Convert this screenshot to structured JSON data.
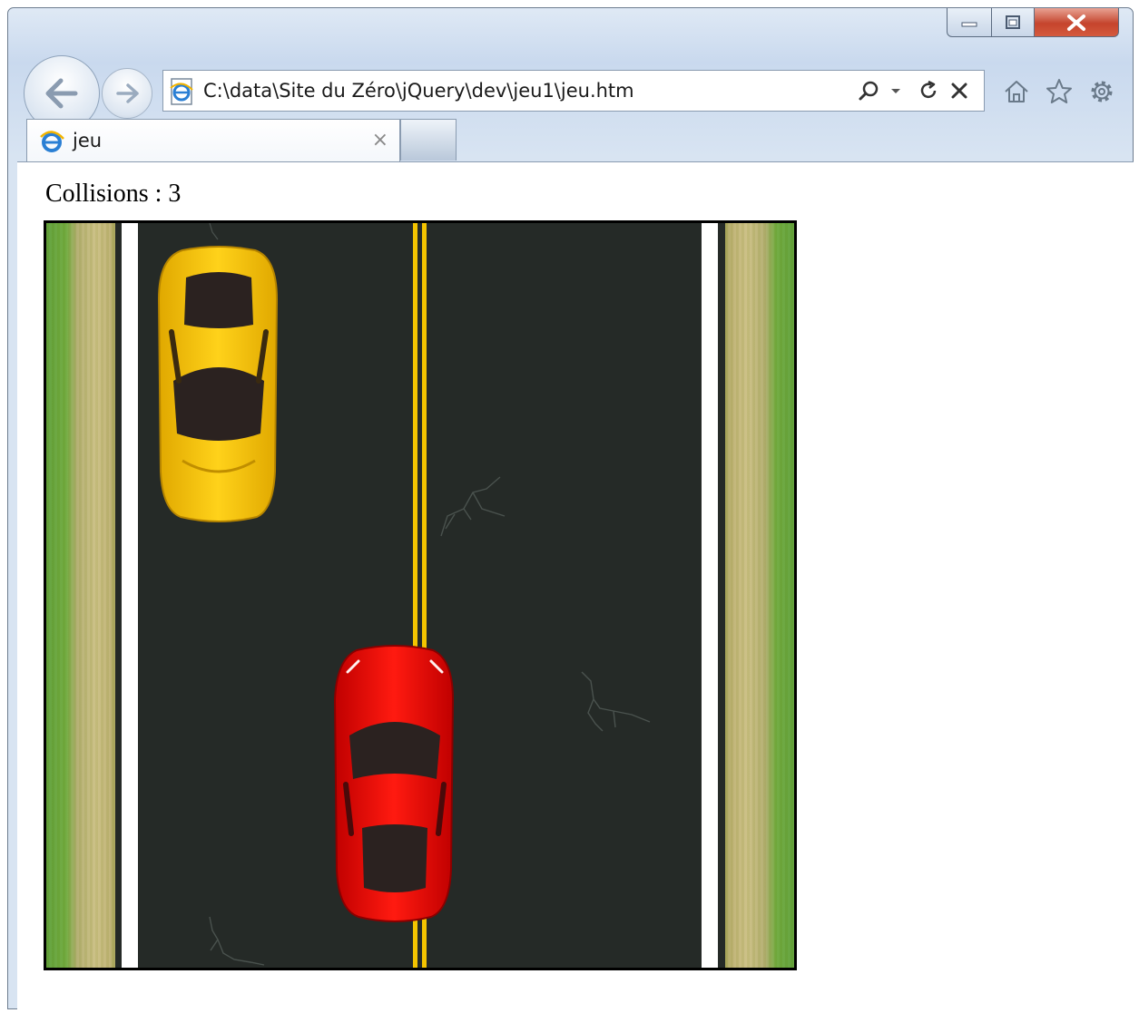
{
  "browser": {
    "address": "C:\\data\\Site du Zéro\\jQuery\\dev\\jeu1\\jeu.htm",
    "tabs": [
      {
        "title": "jeu",
        "close": "×"
      }
    ],
    "caption_buttons": [
      "minimize-icon",
      "maximize-icon",
      "close-icon"
    ],
    "nav_icons": [
      "back-arrow-icon",
      "forward-arrow-icon"
    ],
    "address_controls": [
      "search-icon",
      "dropdown-icon",
      "refresh-icon",
      "stop-icon"
    ],
    "toolbar_icons": [
      "home-icon",
      "favorites-star-icon",
      "gear-icon"
    ]
  },
  "page": {
    "collisions_label": "Collisions : ",
    "collisions_count": "3"
  },
  "game": {
    "colors": {
      "asphalt": "#252a27",
      "center_line": "#f4c400",
      "edge_line": "#ffffff",
      "grass": "#5fa03a",
      "verge": "#cbbf83"
    },
    "cars": [
      {
        "name": "opponent-car",
        "color": "#ffcc00"
      },
      {
        "name": "player-car",
        "color": "#e00000"
      }
    ]
  }
}
